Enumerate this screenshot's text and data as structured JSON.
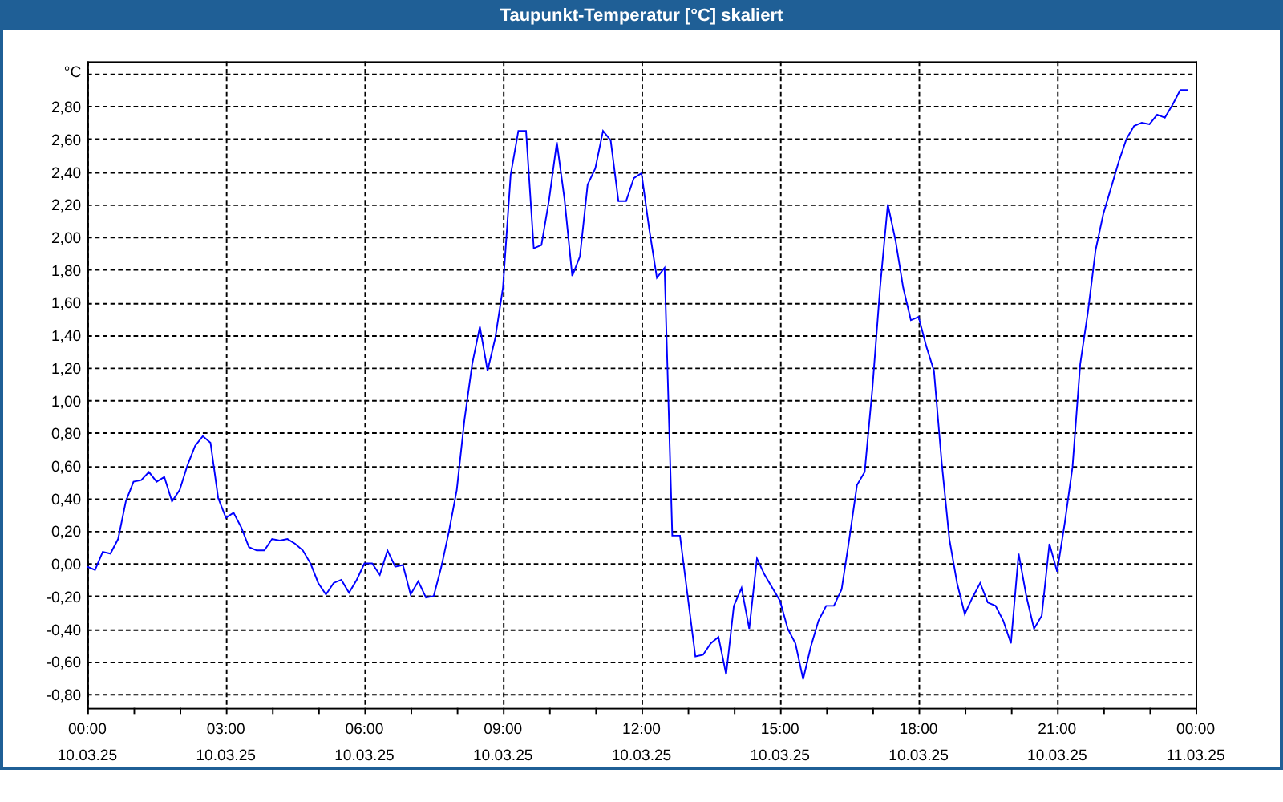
{
  "window": {
    "title": "Taupunkt-Temperatur [°C] skaliert"
  },
  "chart": {
    "chart_data": {
      "type": "line",
      "ylabel": "°C",
      "grid": true,
      "categories": [
        "00:00\n10.03.25",
        null,
        null,
        null,
        null,
        null,
        null,
        null,
        null,
        null,
        null,
        null,
        null,
        null,
        null,
        null,
        null,
        null,
        "03:00\n10.03.25",
        null,
        null,
        null,
        null,
        null,
        null,
        null,
        null,
        null,
        null,
        null,
        null,
        null,
        null,
        null,
        null,
        null,
        "06:00\n10.03.25",
        null,
        null,
        null,
        null,
        null,
        null,
        null,
        null,
        null,
        null,
        null,
        null,
        null,
        null,
        null,
        null,
        null,
        "09:00\n10.03.25",
        null,
        null,
        null,
        null,
        null,
        null,
        null,
        null,
        null,
        null,
        null,
        null,
        null,
        null,
        null,
        null,
        null,
        "12:00\n10.03.25",
        null,
        null,
        null,
        null,
        null,
        null,
        null,
        null,
        null,
        null,
        null,
        null,
        null,
        null,
        null,
        null,
        null,
        "15:00\n10.03.25",
        null,
        null,
        null,
        null,
        null,
        null,
        null,
        null,
        null,
        null,
        null,
        null,
        null,
        null,
        null,
        null,
        null,
        "18:00\n10.03.25",
        null,
        null,
        null,
        null,
        null,
        null,
        null,
        null,
        null,
        null,
        null,
        null,
        null,
        null,
        null,
        null,
        null,
        "21:00\n10.03.25",
        null,
        null,
        null,
        null,
        null,
        null,
        null,
        null,
        null,
        null,
        null,
        null,
        null,
        null,
        null,
        null,
        null,
        "00:00\n11.03.25"
      ],
      "series": [
        {
          "color": "#0000ff",
          "values": [
            -0.02,
            -0.04,
            0.07,
            0.06,
            0.15,
            0.38,
            0.5,
            0.51,
            0.56,
            0.5,
            0.53,
            0.38,
            0.45,
            0.6,
            0.72,
            0.78,
            0.74,
            0.4,
            0.28,
            0.31,
            0.22,
            0.1,
            0.08,
            0.08,
            0.15,
            0.14,
            0.15,
            0.12,
            0.08,
            0.0,
            -0.12,
            -0.19,
            -0.12,
            -0.1,
            -0.18,
            -0.1,
            0.0,
            0.0,
            -0.07,
            0.08,
            -0.02,
            -0.01,
            -0.19,
            -0.11,
            -0.21,
            -0.2,
            -0.02,
            0.2,
            0.45,
            0.88,
            1.22,
            1.45,
            1.18,
            1.38,
            1.69,
            2.38,
            2.65,
            2.65,
            1.93,
            1.95,
            2.23,
            2.58,
            2.23,
            1.76,
            1.88,
            2.32,
            2.42,
            2.65,
            2.59,
            2.22,
            2.22,
            2.36,
            2.39,
            2.05,
            1.75,
            1.81,
            0.17,
            0.17,
            -0.2,
            -0.57,
            -0.56,
            -0.49,
            -0.45,
            -0.68,
            -0.26,
            -0.15,
            -0.4,
            0.03,
            -0.07,
            -0.15,
            -0.23,
            -0.4,
            -0.49,
            -0.71,
            -0.51,
            -0.35,
            -0.26,
            -0.26,
            -0.16,
            0.15,
            0.48,
            0.56,
            1.07,
            1.69,
            2.2,
            1.98,
            1.69,
            1.49,
            1.51,
            1.33,
            1.18,
            0.62,
            0.15,
            -0.12,
            -0.31,
            -0.21,
            -0.12,
            -0.24,
            -0.26,
            -0.35,
            -0.49,
            0.06,
            -0.2,
            -0.4,
            -0.32,
            0.12,
            -0.05,
            0.25,
            0.59,
            1.22,
            1.54,
            1.92,
            2.14,
            2.3,
            2.46,
            2.6,
            2.68,
            2.7,
            2.69,
            2.75,
            2.73,
            2.81,
            2.9,
            2.9,
            null
          ]
        }
      ],
      "ylim": [
        -0.885,
        3.076
      ],
      "yticks": [
        {
          "value": -0.8,
          "label": "-0,80"
        },
        {
          "value": -0.6,
          "label": "-0,60"
        },
        {
          "value": -0.4,
          "label": "-0,40"
        },
        {
          "value": -0.2,
          "label": "-0,20"
        },
        {
          "value": 0,
          "label": "0,00"
        },
        {
          "value": 0.2,
          "label": "0,20"
        },
        {
          "value": 0.4,
          "label": "0,40"
        },
        {
          "value": 0.6,
          "label": "0,60"
        },
        {
          "value": 0.8,
          "label": "0,80"
        },
        {
          "value": 1.0,
          "label": "1,00"
        },
        {
          "value": 1.2,
          "label": "1,20"
        },
        {
          "value": 1.4,
          "label": "1,40"
        },
        {
          "value": 1.6,
          "label": "1,60"
        },
        {
          "value": 1.8,
          "label": "1,80"
        },
        {
          "value": 2.0,
          "label": "2,00"
        },
        {
          "value": 2.2,
          "label": "2,20"
        },
        {
          "value": 2.4,
          "label": "2,40"
        },
        {
          "value": 2.6,
          "label": "2,60"
        },
        {
          "value": 2.8,
          "label": "2,80"
        }
      ]
    }
  }
}
